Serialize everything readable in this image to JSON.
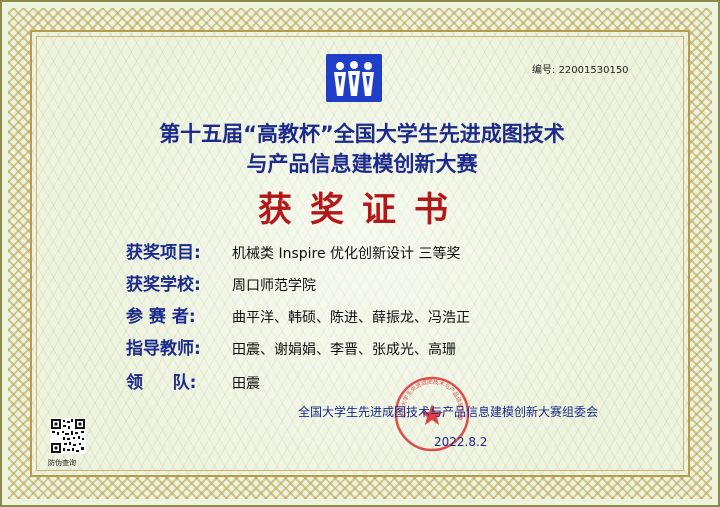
{
  "serial": {
    "label": "编号:",
    "value": "22001530150"
  },
  "title": {
    "line1": "第十五届“高教杯”全国大学生先进成图技术",
    "line2": "与产品信息建模创新大赛"
  },
  "heading": "获奖证书",
  "fields": [
    {
      "label": "获奖项目:",
      "value": "机械类 Inspire 优化创新设计 三等奖"
    },
    {
      "label": "获奖学校:",
      "value": "周口师范学院"
    },
    {
      "label": "参 赛 者:",
      "value": "曲平洋、韩硕、陈进、薛振龙、冯浩正"
    },
    {
      "label": "指导教师:",
      "value": "田震、谢娟娟、李晋、张成光、高珊"
    },
    {
      "label": "领     队:",
      "value": "田震"
    }
  ],
  "committee": "全国大学生先进成图技术与产品信息建模创新大赛组委会",
  "date": "2022.8.2",
  "seal_text": "全国大学生先进成图技术与产品信息建模创新大赛组委会",
  "qr_label": "防伪查询",
  "colors": {
    "title": "#1c2a8c",
    "heading": "#b21818",
    "logo": "#1f3fc9",
    "seal": "#d93030",
    "background": "#eef3de",
    "border": "#b79b4f"
  }
}
